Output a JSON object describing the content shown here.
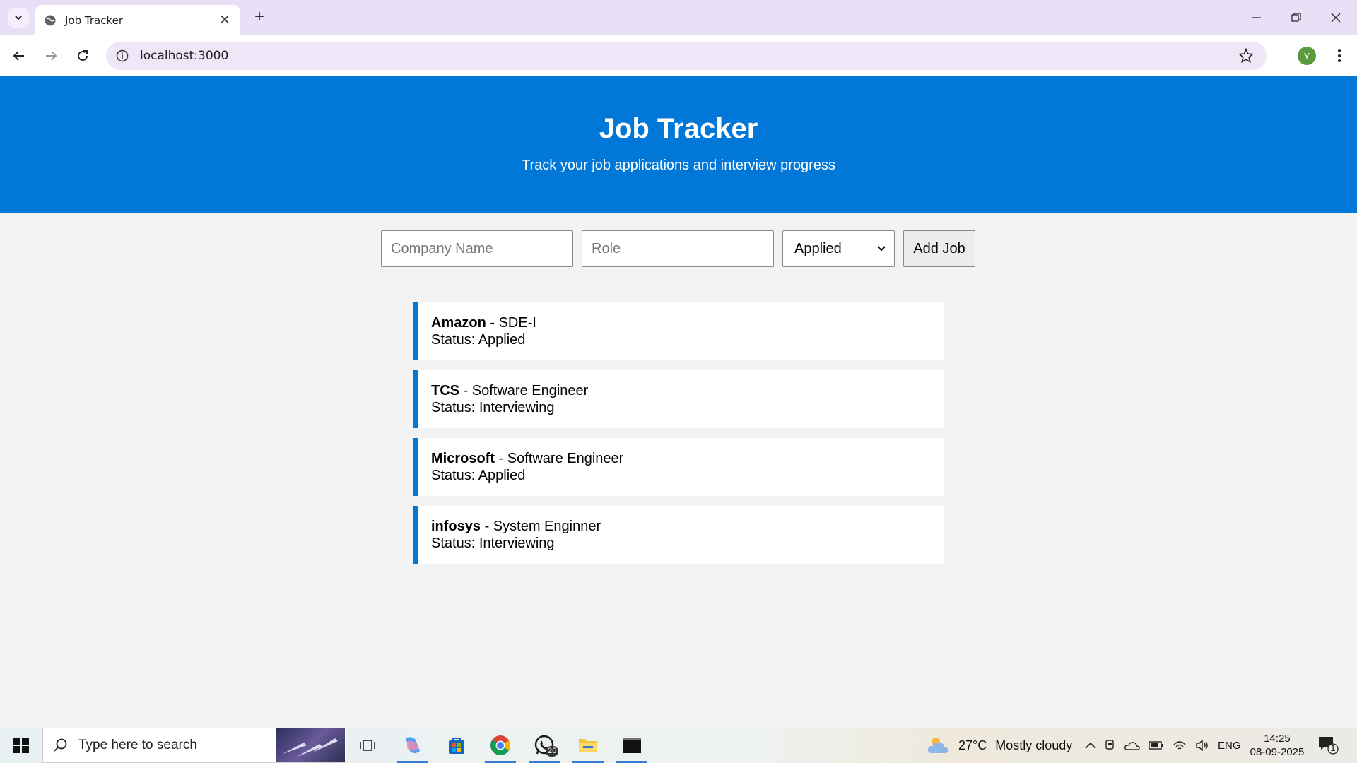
{
  "browser": {
    "tab_title": "Job Tracker",
    "new_tab": "+",
    "close_tab": "✕",
    "url": "localhost:3000",
    "profile_initial": "Y"
  },
  "header": {
    "title": "Job Tracker",
    "subtitle": "Track your job applications and interview progress"
  },
  "form": {
    "company_placeholder": "Company Name",
    "role_placeholder": "Role",
    "status_selected": "Applied",
    "add_button": "Add Job"
  },
  "jobs": [
    {
      "company": "Amazon",
      "role": " - SDE-I",
      "status": "Status: Applied"
    },
    {
      "company": "TCS",
      "role": " - Software Engineer",
      "status": "Status: Interviewing"
    },
    {
      "company": "Microsoft",
      "role": " - Software Engineer",
      "status": "Status: Applied"
    },
    {
      "company": "infosys",
      "role": " - System Enginner",
      "status": "Status: Interviewing"
    }
  ],
  "taskbar": {
    "search_placeholder": "Type here to search",
    "whatsapp_badge": "26",
    "temperature": "27°C",
    "weather": "Mostly cloudy",
    "language": "ENG",
    "time": "14:25",
    "date": "08-09-2025",
    "notification_count": "1"
  },
  "colors": {
    "accent": "#0177d7",
    "tabstrip": "#e9dff6",
    "page_bg": "#f3f3f3"
  }
}
